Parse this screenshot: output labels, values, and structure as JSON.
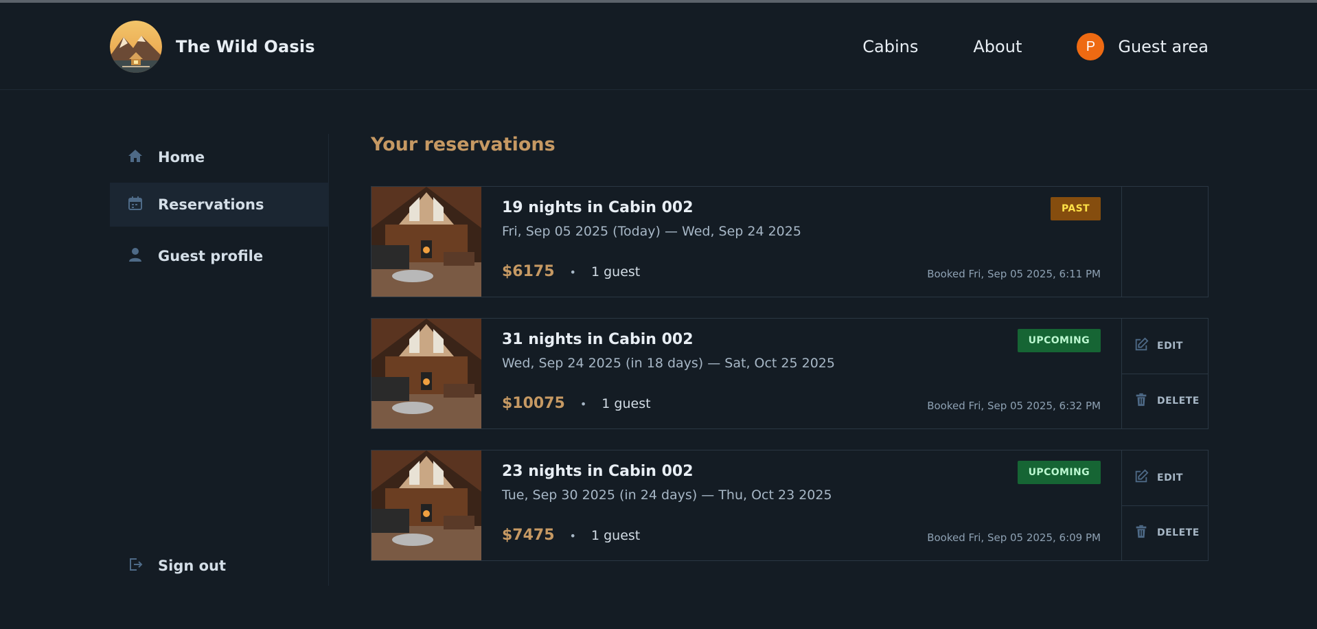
{
  "app": {
    "name": "The Wild Oasis",
    "logo_icon": "mountain-cabin-logo"
  },
  "nav": {
    "cabins": "Cabins",
    "about": "About",
    "guest_initial": "P",
    "guest_area": "Guest area"
  },
  "sidebar": {
    "items": [
      {
        "label": "Home",
        "icon": "home-icon"
      },
      {
        "label": "Reservations",
        "icon": "calendar-icon"
      },
      {
        "label": "Guest profile",
        "icon": "user-icon"
      }
    ],
    "signout": "Sign out"
  },
  "page": {
    "title": "Your reservations"
  },
  "reservations": [
    {
      "title": "19 nights in Cabin 002",
      "dates": "Fri, Sep 05 2025 (Today) — Wed, Sep 24 2025",
      "price": "$6175",
      "separator": "•",
      "guests": "1 guest",
      "booked": "Booked Fri, Sep 05 2025, 6:11 PM",
      "status": "PAST"
    },
    {
      "title": "31 nights in Cabin 002",
      "dates": "Wed, Sep 24 2025 (in 18 days) — Sat, Oct 25 2025",
      "price": "$10075",
      "separator": "•",
      "guests": "1 guest",
      "booked": "Booked Fri, Sep 05 2025, 6:32 PM",
      "status": "UPCOMING",
      "edit": "EDIT",
      "delete": "DELETE"
    },
    {
      "title": "23 nights in Cabin 002",
      "dates": "Tue, Sep 30 2025 (in 24 days) — Thu, Oct 23 2025",
      "price": "$7475",
      "separator": "•",
      "guests": "1 guest",
      "booked": "Booked Fri, Sep 05 2025, 6:09 PM",
      "status": "UPCOMING",
      "edit": "EDIT",
      "delete": "DELETE"
    }
  ],
  "colors": {
    "background": "#141c24",
    "accent": "#c69963",
    "avatar": "#ee6a12",
    "past_badge": "#854d0e",
    "upcoming_badge": "#166534"
  }
}
